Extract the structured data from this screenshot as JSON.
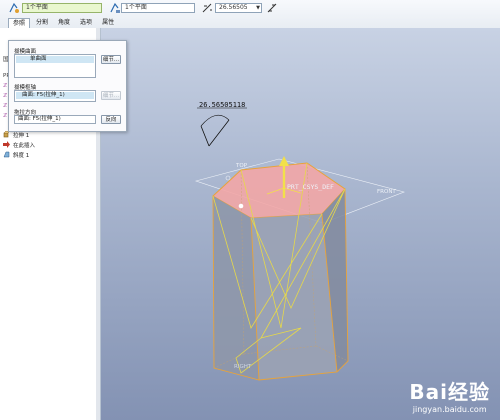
{
  "toolbar": {
    "reference_plane": "1个平面",
    "pivot_plane": "1个平面",
    "angle_value": "26.56505",
    "angle_dropdown_arrow": "▼"
  },
  "tabs": [
    "参照",
    "分割",
    "角度",
    "选项",
    "属性"
  ],
  "panel": {
    "draft_surfaces_label": "拔模曲面",
    "draft_surfaces_value": "单曲面",
    "details_button_1": "细节...",
    "draft_hinges_label": "拔模枢轴",
    "draft_hinges_value": "曲面: F5(拉伸_1)",
    "details_button_2": "细节...",
    "pull_direction_label": "拖拉方向",
    "pull_direction_value": "曲面: F5(拉伸_1)",
    "flip_button": "反向"
  },
  "tree": {
    "items": [
      {
        "label": "拉伸 1",
        "icon": "extrude-icon"
      },
      {
        "label": "在此插入",
        "icon": "insert-here-arrow-icon"
      },
      {
        "label": "斜度 1",
        "icon": "draft-icon"
      }
    ],
    "partial_letters": [
      "国",
      "PR",
      "ℤ",
      "ℤ",
      "ℤ",
      "ℤ"
    ]
  },
  "viewport": {
    "angle_dimension": "26.56505118",
    "top_plane_label": "TOP",
    "csys_label": "PRT_CSYS_DEF",
    "front_plane_label": "FRONT",
    "right_plane_label": "RIGHT"
  },
  "watermark": {
    "main": "Bai经验",
    "url": "jingyan.baidu.com"
  },
  "colors": {
    "selected_surface": "#f2a6a6",
    "model_edges": "#e8a33a",
    "preview_lines": "#e6d84a",
    "background_top": "#c8d2e4",
    "background_bottom": "#8392b3"
  }
}
